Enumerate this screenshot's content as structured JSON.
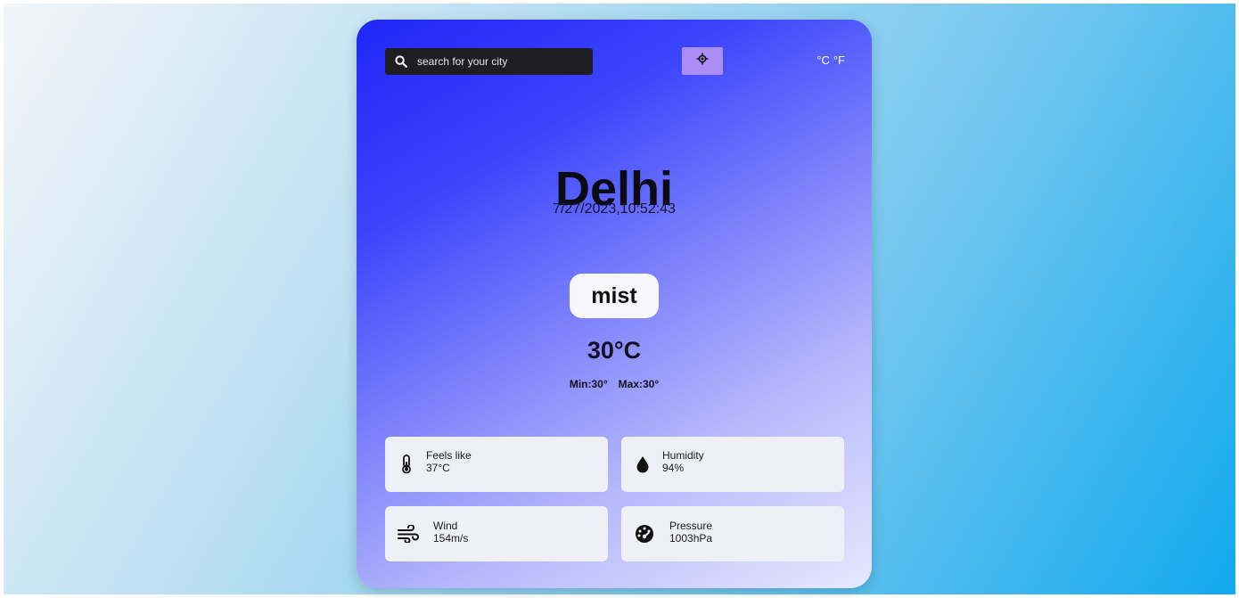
{
  "search": {
    "placeholder": "search for your city",
    "value": ""
  },
  "icons": {
    "search": "search-icon",
    "location": "location-crosshair-icon",
    "feels_like": "thermometer-icon",
    "humidity": "water-drop-icon",
    "wind": "wind-icon",
    "pressure": "gauge-icon"
  },
  "units": {
    "celsius": "°C",
    "fahrenheit": "°F"
  },
  "weather": {
    "city": "Delhi",
    "datetime": "7/27/2023,10:52:43",
    "condition": "mist",
    "temperature": "30°C",
    "min": "Min:30°",
    "max": "Max:30°"
  },
  "details": {
    "feels_like": {
      "label": "Feels like",
      "value": "37°C"
    },
    "humidity": {
      "label": "Humidity",
      "value": "94%"
    },
    "wind": {
      "label": "Wind",
      "value": "154m/s"
    },
    "pressure": {
      "label": "Pressure",
      "value": "1003hPa"
    }
  },
  "colors": {
    "card_gradient_start": "#1f26f6",
    "card_gradient_end": "#e7e8fd",
    "location_button": "#aa8df5",
    "search_bar": "#1e1e22",
    "tile_background": "#eef0f5"
  }
}
